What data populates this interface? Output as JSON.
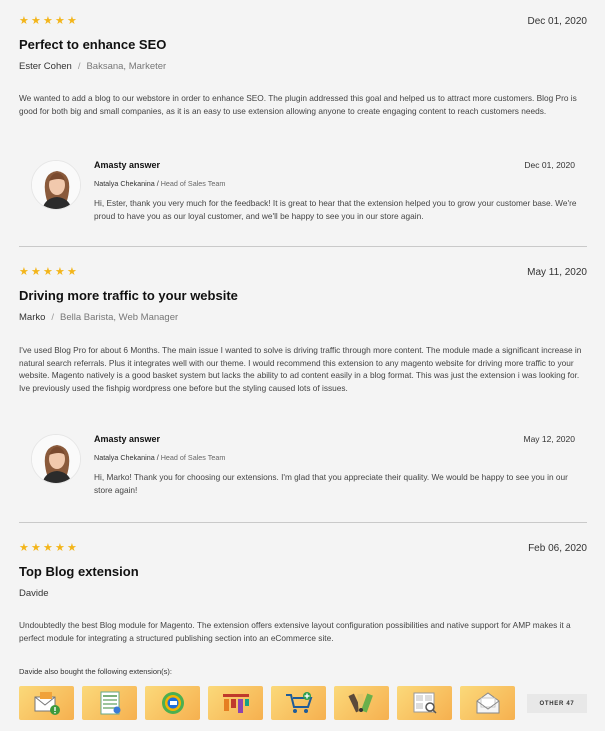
{
  "reviews": [
    {
      "rating": 5,
      "date": "Dec 01, 2020",
      "title": "Perfect to enhance SEO",
      "author": "Ester Cohen",
      "author_role": "Baksana, Marketer",
      "text": "We wanted to add a blog to our webstore in order to enhance SEO. The plugin addressed this goal and helped us to attract more customers. Blog Pro is good for both big and small companies, as it is an easy to use extension allowing anyone to create engaging content to reach customers needs.",
      "answer": {
        "name": "Amasty answer",
        "date": "Dec 01, 2020",
        "staff": "Natalya Chekanina",
        "team": "Head of Sales Team",
        "text": "Hi, Ester, thank you very much for the feedback! It is great to hear that the extension helped you to grow your customer base. We're proud to have you as our loyal customer, and we'll be happy to see you in our store again."
      }
    },
    {
      "rating": 5,
      "date": "May 11, 2020",
      "title": "Driving more traffic to your website",
      "author": "Marko",
      "author_role": "Bella Barista, Web Manager",
      "text": "I've used Blog Pro for about 6 Months. The main issue I wanted to solve is driving traffic through more content. The module made a significant increase in natural search referrals. Plus it integrates well with our theme. I would recommend this extension to any magento website for driving more traffic to your website. Magento natively is a good basket system but lacks the ability to ad content easily in a blog format. This was just the extension i was looking for. Ive previously used the fishpig wordpress one before but the styling caused lots of issues.",
      "answer": {
        "name": "Amasty answer",
        "date": "May 12, 2020",
        "staff": "Natalya Chekanina",
        "team": "Head of Sales Team",
        "text": "Hi, Marko! Thank you for choosing our extensions. I'm glad that you appreciate their quality. We would be happy to see you in our store again!"
      }
    },
    {
      "rating": 5,
      "date": "Feb 06, 2020",
      "title": "Top Blog extension",
      "author": "Davide",
      "text": "Undoubtedly the best Blog module for Magento. The extension offers extensive layout configuration possibilities and native support for AMP makes it a perfect module for integrating a structured publishing section into an eCommerce site."
    }
  ],
  "bought": {
    "label": "Davide also bought the following extension(s):",
    "icons": [
      "envelope-alert-icon",
      "spreadsheet-icon",
      "circle-logo-icon",
      "bar-columns-icon",
      "cart-add-icon",
      "color-swatches-icon",
      "search-grid-icon",
      "open-envelope-icon"
    ],
    "other_label": "OTHER 47"
  },
  "colors": {
    "star": "#f3b51a",
    "divider": "#c9c9c9",
    "thumb_from": "#fbd97a",
    "thumb_to": "#f6b04f"
  }
}
